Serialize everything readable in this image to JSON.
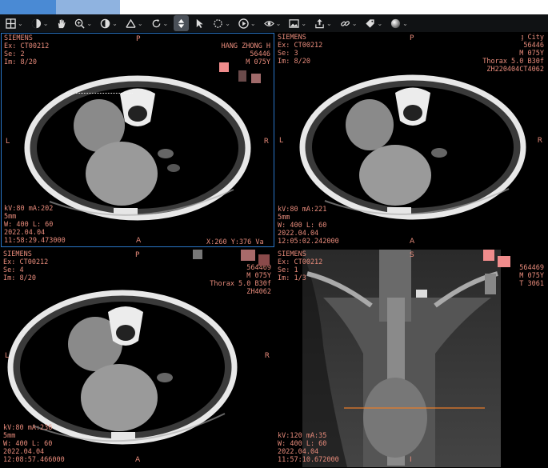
{
  "toolbar": {
    "items": [
      {
        "icon": "layout-grid-icon",
        "caret": "⌄"
      },
      {
        "icon": "window-level-icon",
        "caret": "⌄"
      },
      {
        "icon": "pan-hand-icon",
        "caret": ""
      },
      {
        "icon": "zoom-icon",
        "caret": "⌄"
      },
      {
        "icon": "invert-icon",
        "caret": "⌄"
      },
      {
        "icon": "measure-icon",
        "caret": "⌄"
      },
      {
        "icon": "rotate-icon",
        "caret": "⌄"
      },
      {
        "icon": "scroll-stack-icon",
        "caret": ""
      },
      {
        "icon": "pointer-icon",
        "caret": ""
      },
      {
        "icon": "roi-icon",
        "caret": "⌄"
      },
      {
        "icon": "cine-play-icon",
        "caret": "⌄"
      },
      {
        "icon": "visibility-icon",
        "caret": "⌄"
      },
      {
        "icon": "image-icon",
        "caret": "⌄"
      },
      {
        "icon": "export-icon",
        "caret": "⌄"
      },
      {
        "icon": "link-icon",
        "caret": "⌄"
      },
      {
        "icon": "tag-icon",
        "caret": "⌄"
      },
      {
        "icon": "sphere-icon",
        "caret": "⌄"
      }
    ]
  },
  "viewports": [
    {
      "top_left": "SIEMENS\nEx: CT00212\nSe: 2\nIm: 8/20",
      "top_right": "HANG ZHONG H\n56446\nM 075Y",
      "bottom_left": "kV:80 mA:202\n5mm\nW: 400 L: 60\n2022.04.04\n11:58:29.473000",
      "bottom_right": "X:260 Y:376 Va",
      "orient": {
        "top": "P",
        "left": "L",
        "right": "R",
        "bottom": "A"
      }
    },
    {
      "top_left": "SIEMENS\nEx: CT00212\nSe: 3\nIm: 8/20",
      "top_right": "Hang City\n56446\nM 075Y\nThorax 5.0 B30f\nZH220404CT4062",
      "bottom_left": "kV:80 mA:221\n5mm\nW: 400 L: 60\n2022.04.04\n12:05:02.242000",
      "bottom_right": "",
      "orient": {
        "top": "P",
        "left": "L",
        "right": "R",
        "bottom": "A"
      }
    },
    {
      "top_left": "SIEMENS\nEx: CT00212\nSe: 4\nIm: 8/20",
      "top_right": "564469\nM 075Y\nThorax 5.0 B30f\nZH4062",
      "bottom_left": "kV:80 mA:236\n5mm\nW: 400 L: 60\n2022.04.04\n12:08:57.466000",
      "bottom_right": "",
      "orient": {
        "top": "P",
        "left": "L",
        "right": "R",
        "bottom": "A"
      }
    },
    {
      "top_left": "SIEMENS\nEx: CT00212\nSe: 1\nIm: 1/3",
      "top_right": "564469\nM 075Y\nT 3061",
      "bottom_left": "kV:120 mA:35\nW: 400 L: 60\n2022.04.04\n11:57:10.672000",
      "bottom_right": "",
      "orient": {
        "top": "S",
        "left": "",
        "right": "",
        "bottom": "I"
      }
    }
  ]
}
